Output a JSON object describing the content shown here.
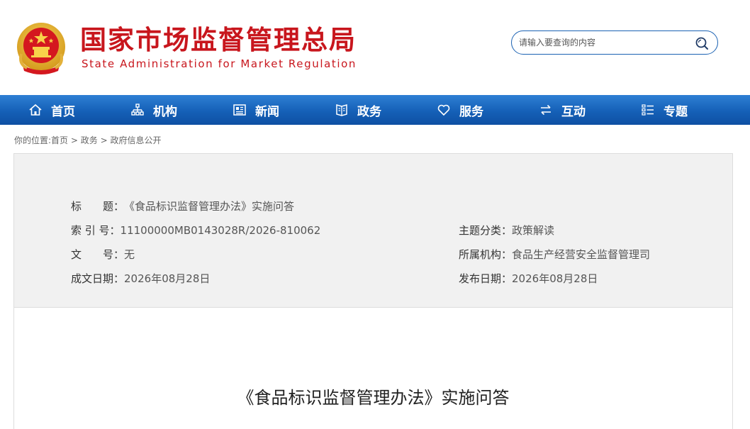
{
  "header": {
    "title_cn": "国家市场监督管理总局",
    "title_en": "State Administration for Market Regulation",
    "brand_color": "#c8161d"
  },
  "search": {
    "placeholder": "请输入要查询的内容",
    "icon": "search-icon"
  },
  "nav": {
    "items": [
      {
        "label": "首页",
        "icon": "home-icon"
      },
      {
        "label": "机构",
        "icon": "org-chart-icon"
      },
      {
        "label": "新闻",
        "icon": "newspaper-icon"
      },
      {
        "label": "政务",
        "icon": "document-icon"
      },
      {
        "label": "服务",
        "icon": "heart-icon"
      },
      {
        "label": "互动",
        "icon": "exchange-arrows-icon"
      },
      {
        "label": "专题",
        "icon": "list-icon"
      }
    ],
    "color": "#1560b7"
  },
  "breadcrumb": {
    "prefix": "你的位置:",
    "items": [
      "首页",
      "政务",
      "政府信息公开"
    ],
    "separator": " > "
  },
  "meta": {
    "title_label": "标　　题：",
    "title_value": "《食品标识监督管理办法》实施问答",
    "index_label": "索 引 号：",
    "index_value": "11100000MB0143028R/2026-810062",
    "topic_label": "主题分类：",
    "topic_value": "政策解读",
    "doc_no_label": "文　　号：",
    "doc_no_value": "无",
    "org_label": "所属机构：",
    "org_value": "食品生产经营安全监督管理司",
    "created_label": "成文日期：",
    "created_value": "2026年08月28日",
    "published_label": "发布日期：",
    "published_value": "2026年08月28日"
  },
  "article": {
    "title": "《食品标识监督管理办法》实施问答"
  }
}
